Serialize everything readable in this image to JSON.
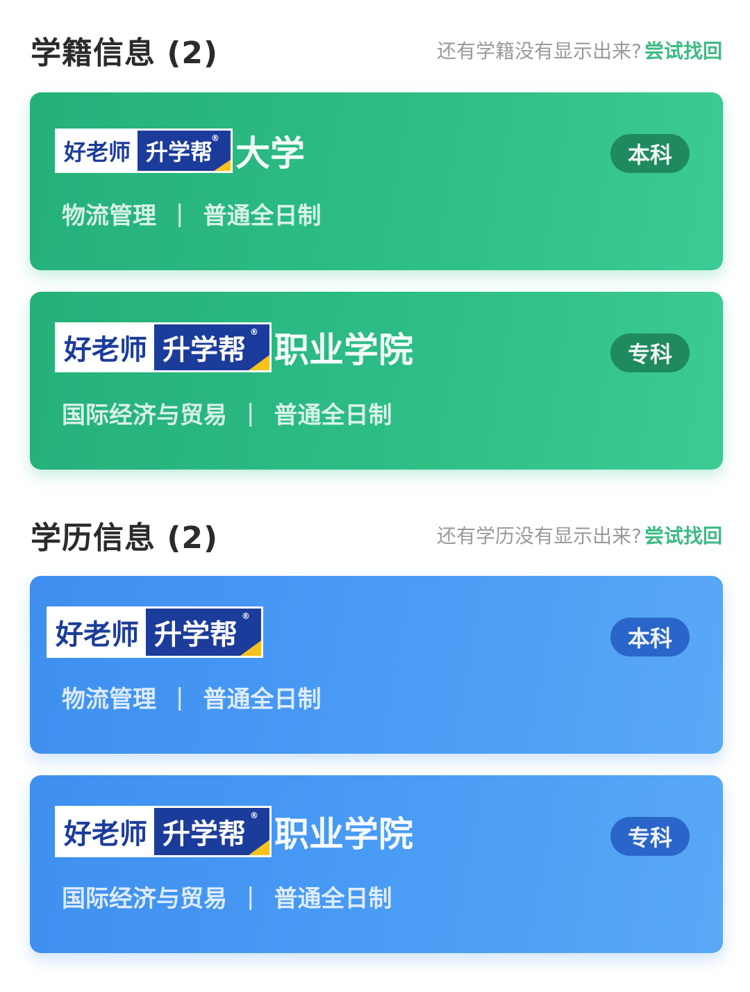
{
  "enrollment": {
    "title": "学籍信息 (2)",
    "hint": "还有学籍没有显示出来?",
    "action": "尝试找回",
    "cards": [
      {
        "school": "大学",
        "level": "本科",
        "major": "物流管理",
        "separator": "|",
        "study_mode": "普通全日制"
      },
      {
        "school": "职业学院",
        "level": "专科",
        "major": "国际经济与贸易",
        "separator": "|",
        "study_mode": "普通全日制"
      }
    ]
  },
  "education": {
    "title": "学历信息 (2)",
    "hint": "还有学历没有显示出来?",
    "action": "尝试找回",
    "cards": [
      {
        "school": "",
        "level": "本科",
        "major": "物流管理",
        "separator": "|",
        "study_mode": "普通全日制"
      },
      {
        "school": "职业学院",
        "level": "专科",
        "major": "国际经济与贸易",
        "separator": "|",
        "study_mode": "普通全日制"
      }
    ]
  },
  "watermark": {
    "left_text": "好老师",
    "right_text": "升学帮",
    "registered": "®"
  },
  "colors": {
    "green_card": "#2dbe85",
    "blue_card": "#4a9cf5",
    "link": "#3cba84",
    "watermark_blue": "#1c3c9b",
    "watermark_yellow": "#f6c21b"
  }
}
